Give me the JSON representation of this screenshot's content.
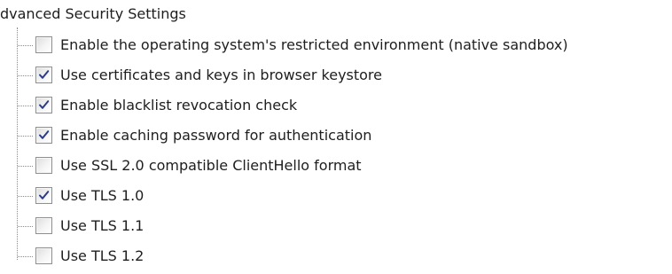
{
  "tree": {
    "root_label": "dvanced Security Settings",
    "items": [
      {
        "label": "Enable the operating system's restricted environment (native sandbox)",
        "checked": false
      },
      {
        "label": "Use certificates and keys in browser keystore",
        "checked": true
      },
      {
        "label": "Enable blacklist revocation check",
        "checked": true
      },
      {
        "label": "Enable caching password for authentication",
        "checked": true
      },
      {
        "label": "Use SSL 2.0 compatible ClientHello format",
        "checked": false
      },
      {
        "label": "Use TLS 1.0",
        "checked": true
      },
      {
        "label": "Use TLS 1.1",
        "checked": false
      },
      {
        "label": "Use TLS 1.2",
        "checked": false
      }
    ]
  },
  "colors": {
    "checkmark": "#2c3a8c",
    "checkbox_border": "#8e8f8f",
    "tree_line": "#8a8a8a",
    "text": "#1e1e1e"
  }
}
